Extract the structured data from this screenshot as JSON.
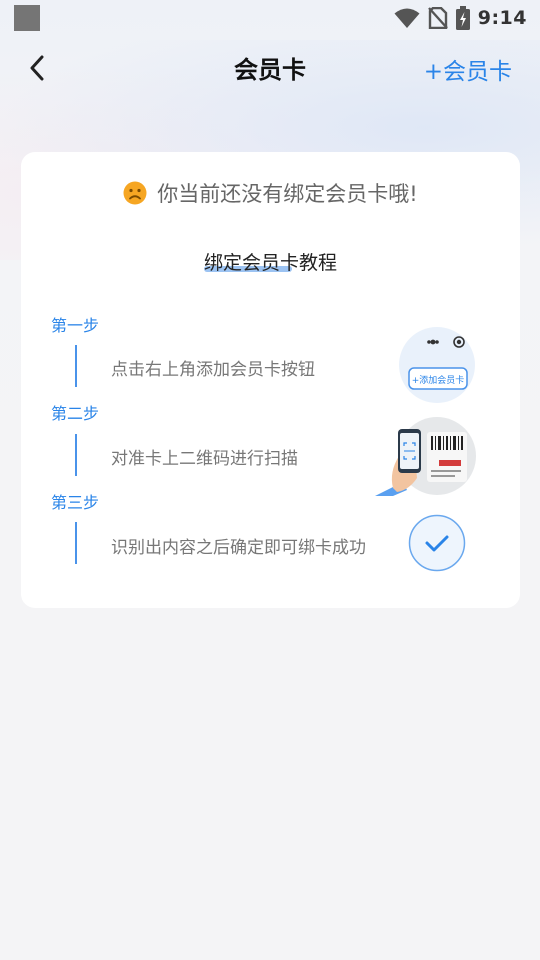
{
  "status_bar": {
    "time": "9:14"
  },
  "nav": {
    "title": "会员卡",
    "add_button_label": "+会员卡"
  },
  "empty_state": {
    "message": "你当前还没有绑定会员卡哦!"
  },
  "tutorial": {
    "title": "绑定会员卡教程",
    "steps": [
      {
        "label": "第一步",
        "description": "点击右上角添加会员卡按钮",
        "illustration_button_text": "+添加会员卡"
      },
      {
        "label": "第二步",
        "description": "对准卡上二维码进行扫描"
      },
      {
        "label": "第三步",
        "description": "识别出内容之后确定即可绑卡成功"
      }
    ]
  },
  "colors": {
    "accent": "#2a84e8",
    "sad_face": "#f6a623"
  },
  "icons": {
    "back": "chevron-left-icon",
    "empty": "sad-face-icon",
    "success": "check-circle-icon"
  }
}
